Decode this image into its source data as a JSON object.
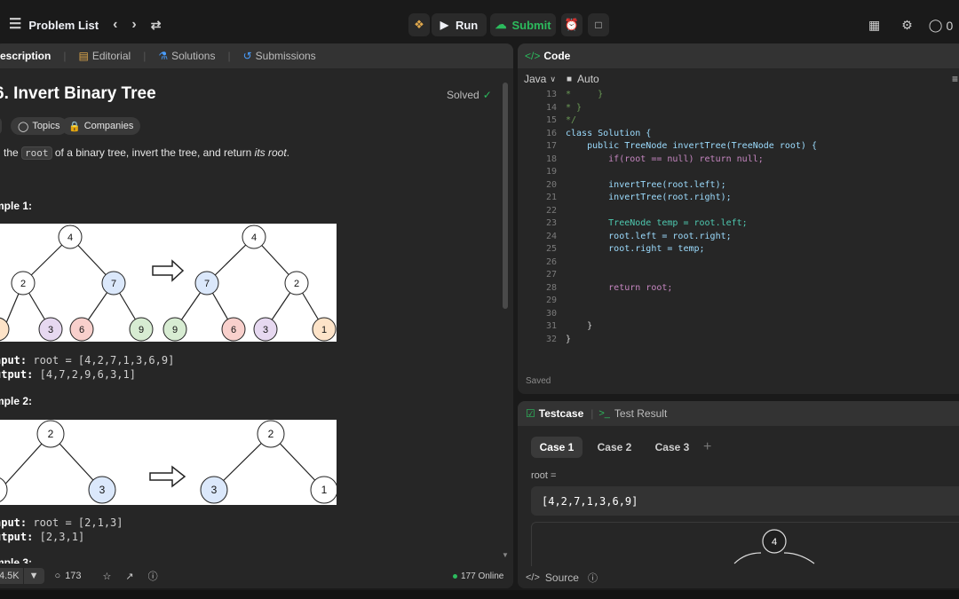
{
  "topbar": {
    "problem_list": "Problem List",
    "run": "Run",
    "submit": "Submit",
    "streak": "0"
  },
  "left_panel": {
    "tabs": [
      "escription",
      "Editorial",
      "Solutions",
      "Submissions"
    ],
    "title": "6. Invert Binary Tree",
    "status": "Solved",
    "tags": [
      "Topics",
      "Companies"
    ],
    "statement": {
      "pre": "n the ",
      "code": "root",
      "mid": " of a binary tree, invert the tree, and return ",
      "em": "its root",
      "post": "."
    },
    "example1": {
      "label": "mple 1:",
      "input_label": "nput:",
      "input_value": "root = [4,2,7,1,3,6,9]",
      "output_label": "utput:",
      "output_value": "[4,7,2,9,6,3,1]",
      "left_tree": [
        "4",
        "2",
        "7",
        "3",
        "6",
        "9"
      ],
      "right_tree": [
        "4",
        "7",
        "2",
        "9",
        "6",
        "3",
        "1"
      ]
    },
    "example2": {
      "label": "mple 2:",
      "input_label": "nput:",
      "input_value": "root = [2,1,3]",
      "output_label": "utput:",
      "output_value": "[2,3,1]",
      "left_tree": [
        "2",
        "3"
      ],
      "right_tree": [
        "2",
        "3",
        "1"
      ]
    },
    "example3_label": "mple 3:",
    "footer": {
      "likes": "4.5K",
      "comments": "173",
      "online": "177 Online"
    }
  },
  "code_panel": {
    "title": "Code",
    "language": "Java",
    "mode": "Auto",
    "status": "Saved",
    "lines": [
      {
        "n": "13",
        "t": "*     }"
      },
      {
        "n": "14",
        "t": "* }"
      },
      {
        "n": "15",
        "t": "*/"
      },
      {
        "n": "16",
        "t": "class Solution {"
      },
      {
        "n": "17",
        "t": "    public TreeNode invertTree(TreeNode root) {"
      },
      {
        "n": "18",
        "t": "        if(root == null) return null;"
      },
      {
        "n": "19",
        "t": ""
      },
      {
        "n": "20",
        "t": "        invertTree(root.left);"
      },
      {
        "n": "21",
        "t": "        invertTree(root.right);"
      },
      {
        "n": "22",
        "t": ""
      },
      {
        "n": "23",
        "t": "        TreeNode temp = root.left;"
      },
      {
        "n": "24",
        "t": "        root.left = root.right;"
      },
      {
        "n": "25",
        "t": "        root.right = temp;"
      },
      {
        "n": "26",
        "t": ""
      },
      {
        "n": "27",
        "t": ""
      },
      {
        "n": "28",
        "t": "        return root;"
      },
      {
        "n": "29",
        "t": ""
      },
      {
        "n": "30",
        "t": ""
      },
      {
        "n": "31",
        "t": "    }"
      },
      {
        "n": "32",
        "t": "}"
      }
    ]
  },
  "test_panel": {
    "tab_testcase": "Testcase",
    "tab_result": "Test Result",
    "cases": [
      "Case 1",
      "Case 2",
      "Case 3"
    ],
    "add": "+",
    "param_label": "root =",
    "param_value": "[4,2,7,1,3,6,9]",
    "tree_root": "4",
    "source": "Source"
  }
}
